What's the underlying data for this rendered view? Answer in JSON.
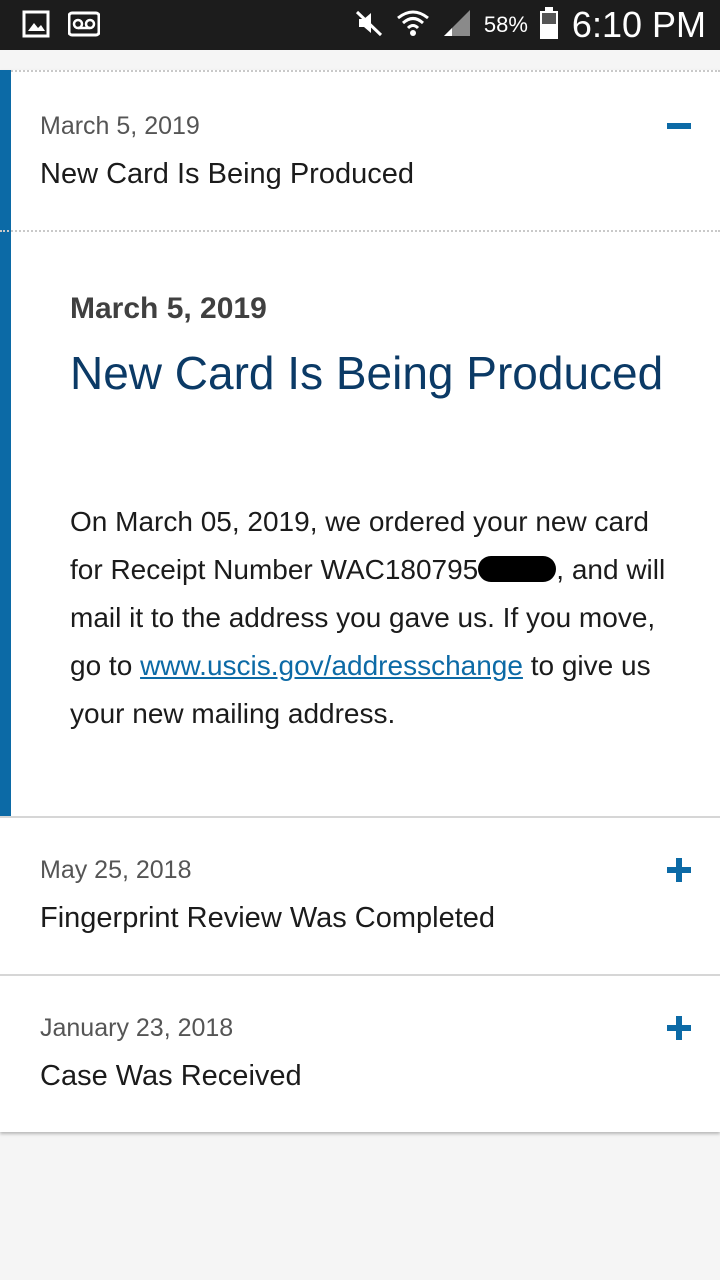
{
  "status_bar": {
    "battery_percent": "58%",
    "time": "6:10 PM",
    "icons": [
      "gallery-icon",
      "voicemail-icon",
      "mute-icon",
      "wifi-icon",
      "signal-icon",
      "battery-icon"
    ]
  },
  "colors": {
    "accent": "#0c6aa6",
    "title": "#0b3a66"
  },
  "case_history": {
    "items": [
      {
        "date": "March 5, 2019",
        "title": "New Card Is Being Produced",
        "expanded": true,
        "toggle": "minus"
      },
      {
        "date": "May 25, 2018",
        "title": "Fingerprint Review Was Completed",
        "expanded": false,
        "toggle": "plus"
      },
      {
        "date": "January 23, 2018",
        "title": "Case Was Received",
        "expanded": false,
        "toggle": "plus"
      }
    ],
    "detail": {
      "date": "March 5, 2019",
      "title": "New Card Is Being Produced",
      "body_part1": "On March 05, 2019, we ordered your new card for Receipt Number WAC180795",
      "body_part2": ", and will mail it to the address you gave us. If you move, go to ",
      "link_text": "www.uscis.gov/addresschange",
      "body_part3": " to give us your new mailing address."
    }
  }
}
